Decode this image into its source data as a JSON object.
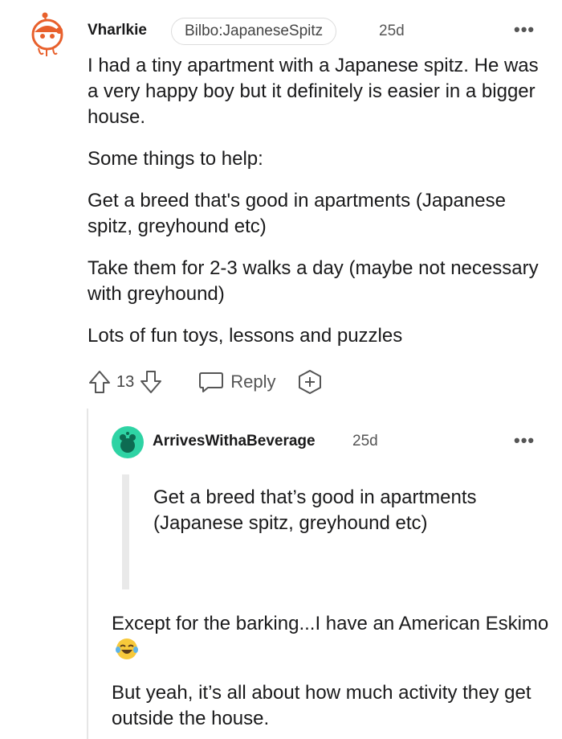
{
  "comment": {
    "username": "Vharlkie",
    "flair": "Bilbo:JapaneseSpitz",
    "age": "25d",
    "more_label": "•••",
    "paragraphs": [
      "I had a tiny apartment with a Japanese spitz. He was a very happy boy but it definitely is easier in a bigger house.",
      "Some things to help:",
      "Get a breed that's good in apartments (Japanese spitz, greyhound etc)",
      "Take them for 2-3 walks a day (maybe not necessary with greyhound)",
      "Lots of fun toys, lessons and puzzles"
    ],
    "vote_count": "13",
    "reply_label": "Reply"
  },
  "reply": {
    "username": "ArrivesWithaBeverage",
    "age": "25d",
    "more_label": "•••",
    "quote": "Get a breed that’s good in apartments (Japanese spitz, greyhound etc)",
    "paragraph1": "Except for the barking...I have an American Eskimo",
    "paragraph2": "But yeah, it’s all about how much activity they get outside the house."
  },
  "icons": {
    "avatar_main": "snoo-avatar-icon",
    "avatar_reply": "snoo-avatar-teal-icon",
    "upvote": "upvote-arrow-icon",
    "downvote": "downvote-arrow-icon",
    "reply": "speech-bubble-icon",
    "award": "add-award-icon",
    "emoji": "tears-of-joy-emoji-icon"
  },
  "colors": {
    "text": "#1a1a1b",
    "meta": "#555555",
    "snoo_orange": "#e8602c",
    "reply_avatar": "#2ed3a4"
  }
}
